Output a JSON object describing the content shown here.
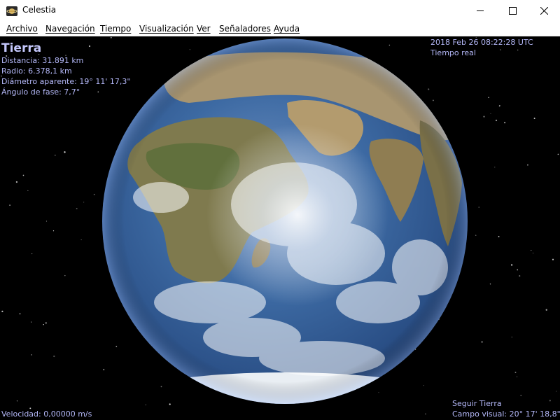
{
  "window": {
    "title": "Celestia",
    "icon": "celestia-app-icon",
    "controls": [
      "minimize-icon",
      "maximize-icon",
      "close-icon"
    ]
  },
  "menu": {
    "items": [
      {
        "label": "Archivo"
      },
      {
        "label": "Navegación"
      },
      {
        "label": "Tiempo"
      },
      {
        "label": "Visualización"
      },
      {
        "label": "Ver"
      },
      {
        "label": "Señaladores"
      },
      {
        "label": "Ayuda"
      }
    ]
  },
  "object_info": {
    "name": "Tierra",
    "distance": "Distancia: 31.891 km",
    "radius": "Radio: 6.378,1 km",
    "apparent_diameter": "Diámetro aparente: 19° 11' 17,3\"",
    "phase_angle": "Ángulo de fase: 7,7°"
  },
  "time_info": {
    "datetime": "2018 Feb 26 08:22:28 UTC",
    "mode": "Tiempo real"
  },
  "status": {
    "velocity": "Velocidad: 0,00000 m/s",
    "follow": "Seguir Tierra",
    "field_of_view": "Campo visual: 20° 17' 18,8\""
  },
  "colors": {
    "hud_text": "#b3b7f7",
    "space": "#000000",
    "ocean": "#2f5f9c",
    "land": "#8a7a55"
  }
}
